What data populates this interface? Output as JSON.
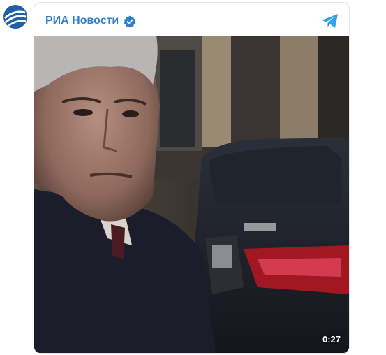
{
  "channel": {
    "name": "РИА Новости",
    "verified": true,
    "avatar_icon": "ria-globe-logo-icon",
    "telegram_icon": "telegram-plane-icon",
    "accent_color": "#2f7ec9"
  },
  "video": {
    "duration": "0:27"
  }
}
